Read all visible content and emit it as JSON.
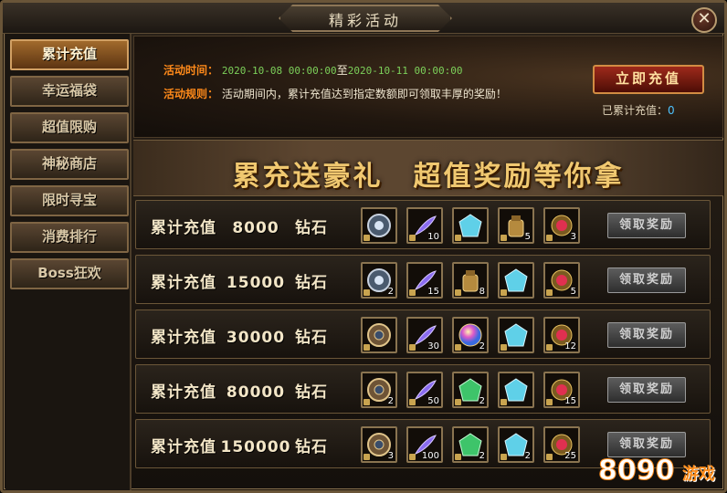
{
  "window": {
    "title": "精彩活动",
    "close_glyph": "✕"
  },
  "sidebar": {
    "items": [
      {
        "label": "累计充值",
        "active": true
      },
      {
        "label": "幸运福袋",
        "active": false
      },
      {
        "label": "超值限购",
        "active": false
      },
      {
        "label": "神秘商店",
        "active": false
      },
      {
        "label": "限时寻宝",
        "active": false
      },
      {
        "label": "消费排行",
        "active": false
      },
      {
        "label": "Boss狂欢",
        "active": false
      }
    ]
  },
  "header": {
    "time_label": "活动时间：",
    "time_start": "2020-10-08 00:00:00",
    "time_to": "至",
    "time_end": "2020-10-11 00:00:00",
    "rule_label": "活动规则：",
    "rule_text": "活动期间内，累计充值达到指定数额即可领取丰厚的奖励！",
    "recharge_button": "立即充值",
    "total_label": "已累计充值：",
    "total_value": "0"
  },
  "banner": {
    "text": "累充送豪礼　超值奖励等你拿"
  },
  "rows": [
    {
      "prefix": "累计充值",
      "amount": "8000",
      "unit": "钻石",
      "button": "领取奖励",
      "items": [
        {
          "icon": "compass-icon",
          "count": ""
        },
        {
          "icon": "feather-icon",
          "count": "10"
        },
        {
          "icon": "gem-icon",
          "count": ""
        },
        {
          "icon": "pouch-icon",
          "count": "5"
        },
        {
          "icon": "ruby-amulet-icon",
          "count": "3"
        }
      ]
    },
    {
      "prefix": "累计充值",
      "amount": "15000",
      "unit": "钻石",
      "button": "领取奖励",
      "items": [
        {
          "icon": "compass-icon",
          "count": "2"
        },
        {
          "icon": "feather-icon",
          "count": "15"
        },
        {
          "icon": "pouch-icon",
          "count": "8"
        },
        {
          "icon": "gem-icon",
          "count": ""
        },
        {
          "icon": "ruby-amulet-icon",
          "count": "5"
        }
      ]
    },
    {
      "prefix": "累计充值",
      "amount": "30000",
      "unit": "钻石",
      "button": "领取奖励",
      "items": [
        {
          "icon": "bronze-compass-icon",
          "count": ""
        },
        {
          "icon": "feather-icon",
          "count": "30"
        },
        {
          "icon": "rainbow-orb-icon",
          "count": "2"
        },
        {
          "icon": "gem-icon",
          "count": ""
        },
        {
          "icon": "ruby-amulet-icon",
          "count": "12"
        }
      ]
    },
    {
      "prefix": "累计充值",
      "amount": "80000",
      "unit": "钻石",
      "button": "领取奖励",
      "items": [
        {
          "icon": "bronze-compass-icon",
          "count": "2"
        },
        {
          "icon": "feather-icon",
          "count": "50"
        },
        {
          "icon": "green-gem-icon",
          "count": "2"
        },
        {
          "icon": "gem-icon",
          "count": ""
        },
        {
          "icon": "ruby-amulet-icon",
          "count": "15"
        }
      ]
    },
    {
      "prefix": "累计充值",
      "amount": "150000",
      "unit": "钻石",
      "button": "领取奖励",
      "items": [
        {
          "icon": "bronze-compass-icon",
          "count": "3"
        },
        {
          "icon": "feather-icon",
          "count": "100"
        },
        {
          "icon": "green-gem-icon",
          "count": "2"
        },
        {
          "icon": "gem-icon",
          "count": "2"
        },
        {
          "icon": "ruby-amulet-icon",
          "count": "25"
        }
      ]
    }
  ],
  "watermark": {
    "number": "8090",
    "text": "游戏"
  }
}
